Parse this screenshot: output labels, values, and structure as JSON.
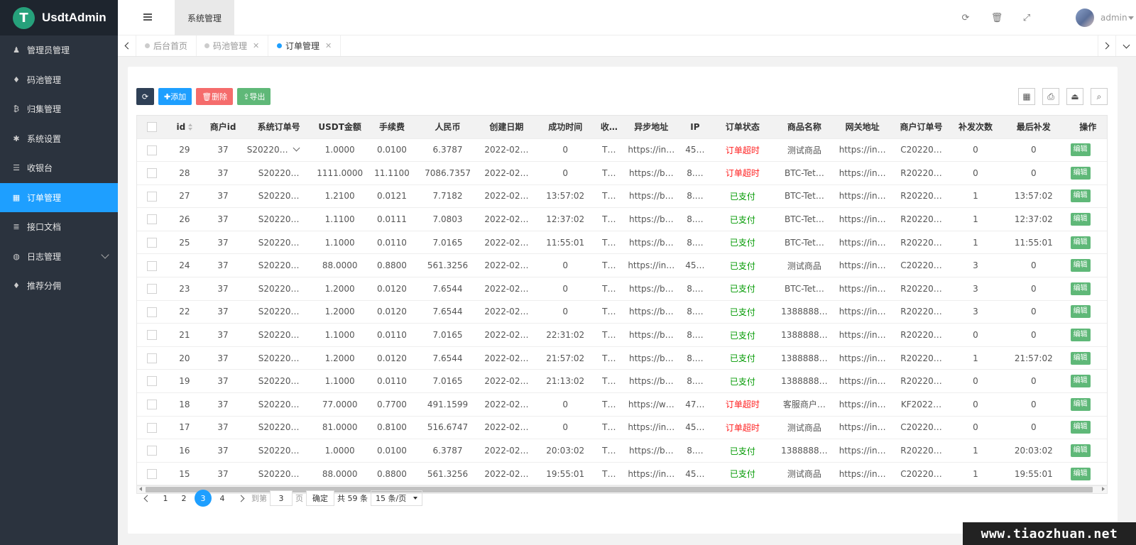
{
  "app": {
    "logo_letter": "T",
    "name": "UsdtAdmin"
  },
  "sidebar": {
    "items": [
      {
        "label": "管理员管理",
        "icon": "user-icon",
        "glyph": "♟"
      },
      {
        "label": "码池管理",
        "icon": "android-icon",
        "glyph": "♦"
      },
      {
        "label": "归集管理",
        "icon": "bitcoin-icon",
        "glyph": "₿"
      },
      {
        "label": "系统设置",
        "icon": "gear-icon",
        "glyph": "✱"
      },
      {
        "label": "收银台",
        "icon": "list-icon",
        "glyph": "☰"
      },
      {
        "label": "订单管理",
        "icon": "calculator-icon",
        "glyph": "▦",
        "active": true
      },
      {
        "label": "接口文档",
        "icon": "document-icon",
        "glyph": "≣"
      },
      {
        "label": "日志管理",
        "icon": "globe-icon",
        "glyph": "◍",
        "expandable": true
      },
      {
        "label": "推荐分佣",
        "icon": "android-icon",
        "glyph": "♦"
      }
    ]
  },
  "header": {
    "system_tab": "系统管理",
    "user_name": "admin"
  },
  "tabs": [
    {
      "label": "后台首页",
      "closable": false,
      "active": false
    },
    {
      "label": "码池管理",
      "closable": true,
      "active": false
    },
    {
      "label": "订单管理",
      "closable": true,
      "active": true
    }
  ],
  "toolbar": {
    "add_label": "✚添加",
    "delete_label": "🗑删除",
    "export_label": "⇪导出"
  },
  "table": {
    "columns": [
      "id",
      "商户id",
      "系统订单号",
      "USDT金额",
      "手续费",
      "人民币",
      "创建日期",
      "成功时间",
      "收…",
      "异步地址",
      "IP",
      "订单状态",
      "商品名称",
      "网关地址",
      "商户订单号",
      "补发次数",
      "最后补发",
      "操作"
    ],
    "edit_label": "编辑",
    "rows": [
      [
        "29",
        "37",
        "S20220…",
        "1.0000",
        "0.0100",
        "6.3787",
        "2022-02…",
        "0",
        "T…",
        "https://in…",
        "45…",
        "订单超时",
        "测试商品",
        "https://in…",
        "C20220…",
        "0",
        "0"
      ],
      [
        "28",
        "37",
        "S20220…",
        "1111.0000",
        "11.1100",
        "7086.7357",
        "2022-02…",
        "0",
        "T…",
        "https://b…",
        "8.…",
        "订单超时",
        "BTC-Tet…",
        "https://in…",
        "R20220…",
        "0",
        "0"
      ],
      [
        "27",
        "37",
        "S20220…",
        "1.2100",
        "0.0121",
        "7.7182",
        "2022-02…",
        "13:57:02",
        "T…",
        "https://b…",
        "8.…",
        "已支付",
        "BTC-Tet…",
        "https://in…",
        "R20220…",
        "1",
        "13:57:02"
      ],
      [
        "26",
        "37",
        "S20220…",
        "1.1100",
        "0.0111",
        "7.0803",
        "2022-02…",
        "12:37:02",
        "T…",
        "https://b…",
        "8.…",
        "已支付",
        "BTC-Tet…",
        "https://in…",
        "R20220…",
        "1",
        "12:37:02"
      ],
      [
        "25",
        "37",
        "S20220…",
        "1.1000",
        "0.0110",
        "7.0165",
        "2022-02…",
        "11:55:01",
        "T…",
        "https://b…",
        "8.…",
        "已支付",
        "BTC-Tet…",
        "https://in…",
        "R20220…",
        "1",
        "11:55:01"
      ],
      [
        "24",
        "37",
        "S20220…",
        "88.0000",
        "0.8800",
        "561.3256",
        "2022-02…",
        "0",
        "T…",
        "https://in…",
        "45…",
        "已支付",
        "测试商品",
        "https://in…",
        "C20220…",
        "3",
        "0"
      ],
      [
        "23",
        "37",
        "S20220…",
        "1.2000",
        "0.0120",
        "7.6544",
        "2022-02…",
        "0",
        "T…",
        "https://b…",
        "8.…",
        "已支付",
        "BTC-Tet…",
        "https://in…",
        "R20220…",
        "3",
        "0"
      ],
      [
        "22",
        "37",
        "S20220…",
        "1.2000",
        "0.0120",
        "7.6544",
        "2022-02…",
        "0",
        "T…",
        "https://b…",
        "8.…",
        "已支付",
        "1388888…",
        "https://in…",
        "R20220…",
        "3",
        "0"
      ],
      [
        "21",
        "37",
        "S20220…",
        "1.1000",
        "0.0110",
        "7.0165",
        "2022-02…",
        "22:31:02",
        "T…",
        "https://b…",
        "8.…",
        "已支付",
        "1388888…",
        "https://in…",
        "R20220…",
        "0",
        "0"
      ],
      [
        "20",
        "37",
        "S20220…",
        "1.2000",
        "0.0120",
        "7.6544",
        "2022-02…",
        "21:57:02",
        "T…",
        "https://b…",
        "8.…",
        "已支付",
        "1388888…",
        "https://in…",
        "R20220…",
        "1",
        "21:57:02"
      ],
      [
        "19",
        "37",
        "S20220…",
        "1.1000",
        "0.0110",
        "7.0165",
        "2022-02…",
        "21:13:02",
        "T…",
        "https://b…",
        "8.…",
        "已支付",
        "1388888…",
        "https://in…",
        "R20220…",
        "0",
        "0"
      ],
      [
        "18",
        "37",
        "S20220…",
        "77.0000",
        "0.7700",
        "491.1599",
        "2022-02…",
        "0",
        "T…",
        "https://w…",
        "47…",
        "订单超时",
        "客服商户…",
        "https://in…",
        "KF2022…",
        "0",
        "0"
      ],
      [
        "17",
        "37",
        "S20220…",
        "81.0000",
        "0.8100",
        "516.6747",
        "2022-02…",
        "0",
        "T…",
        "https://in…",
        "45…",
        "订单超时",
        "测试商品",
        "https://in…",
        "C20220…",
        "0",
        "0"
      ],
      [
        "16",
        "37",
        "S20220…",
        "1.0000",
        "0.0100",
        "6.3787",
        "2022-02…",
        "20:03:02",
        "T…",
        "https://b…",
        "8.…",
        "已支付",
        "1388888…",
        "https://in…",
        "R20220…",
        "1",
        "20:03:02"
      ],
      [
        "15",
        "37",
        "S20220…",
        "88.0000",
        "0.8800",
        "561.3256",
        "2022-02…",
        "19:55:01",
        "T…",
        "https://in…",
        "45…",
        "已支付",
        "测试商品",
        "https://in…",
        "C20220…",
        "1",
        "19:55:01"
      ]
    ]
  },
  "pagination": {
    "pages": [
      "1",
      "2",
      "3",
      "4"
    ],
    "current": "3",
    "goto_label": "到第",
    "goto_value": "3",
    "page_unit": "页",
    "confirm_label": "确定",
    "total_label": "共 59 条",
    "page_size_label": "15 条/页"
  },
  "colors": {
    "accent": "#1e9fff",
    "sidebar_bg": "#2b333e",
    "status_timeout": "#ff1f1f",
    "status_paid": "#009900",
    "edit_button": "#5fb878"
  },
  "watermark": "www.tiaozhuan.net"
}
